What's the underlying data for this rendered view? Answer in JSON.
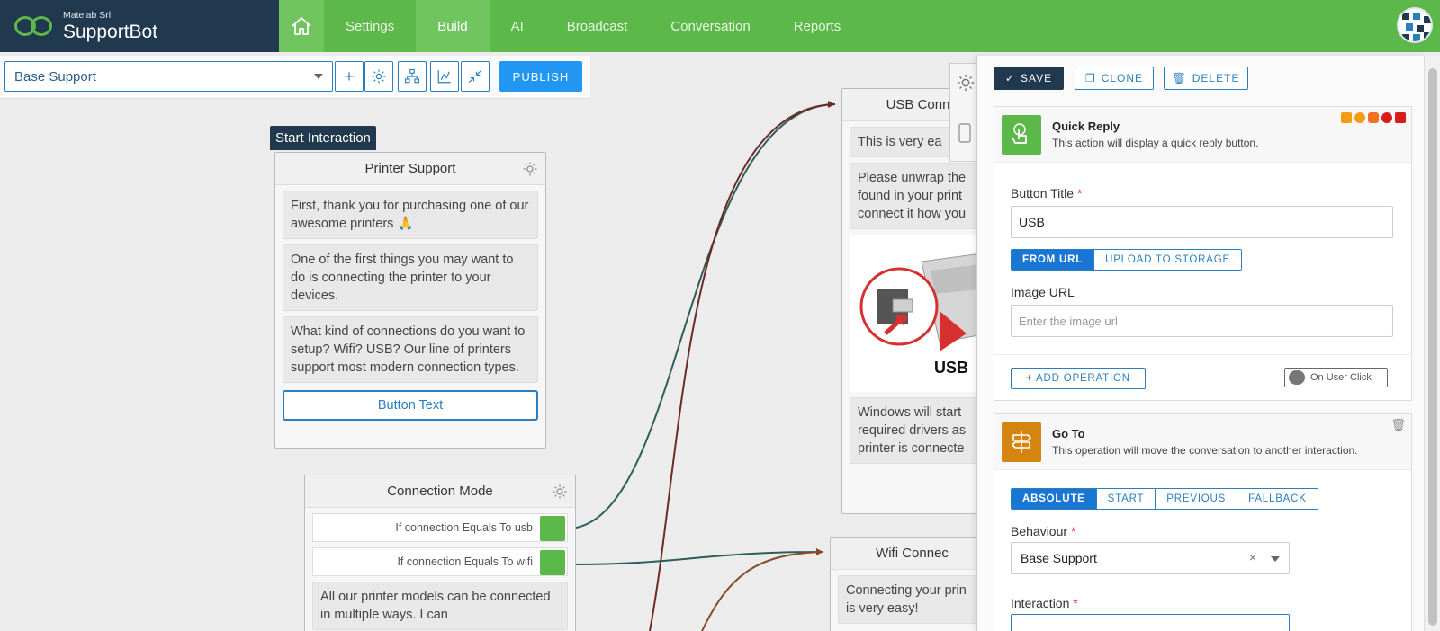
{
  "app": {
    "company": "Matelab Srl",
    "name": "SupportBot"
  },
  "nav": {
    "items": [
      {
        "label": "Settings",
        "active": false
      },
      {
        "label": "Build",
        "active": true
      },
      {
        "label": "AI",
        "active": false
      },
      {
        "label": "Broadcast",
        "active": false
      },
      {
        "label": "Conversation",
        "active": false
      },
      {
        "label": "Reports",
        "active": false
      }
    ]
  },
  "toolbar": {
    "flow_selected": "Base Support",
    "publish_label": "PUBLISH",
    "buttons": [
      "plus-icon",
      "gear-icon",
      "hierarchy-icon",
      "chart-icon",
      "compress-icon"
    ]
  },
  "canvas": {
    "start_tag": "Start Interaction",
    "printer_node": {
      "title": "Printer Support",
      "bubbles": [
        "First, thank you for purchasing one of our awesome printers 🙏",
        "One of the first things you may want to do is connecting the printer to your devices.",
        "What kind of connections do you want to setup? Wifi? USB? Our line of printers support most modern connection types."
      ],
      "button_text": "Button Text"
    },
    "connection_node": {
      "title": "Connection Mode",
      "conditions": [
        "If connection Equals To usb",
        "If connection Equals To wifi"
      ],
      "bubble": "All our printer models can be connected in multiple ways. I can"
    },
    "usb_node": {
      "title": "USB Conn",
      "bubbles": [
        "This is very ea",
        "Please unwrap the found in your print connect it how you",
        "Windows will start required drivers as printer is connecte"
      ],
      "image_caption": "USB"
    },
    "wifi_node": {
      "title": "Wifi Connec",
      "bubble": "Connecting your prin is very easy!"
    }
  },
  "panel": {
    "save_label": "SAVE",
    "clone_label": "CLONE",
    "delete_label": "DELETE",
    "quick_reply": {
      "title": "Quick Reply",
      "description": "This action will display a quick reply button.",
      "button_title_label": "Button Title",
      "button_title_value": "USB",
      "source_tabs": [
        {
          "label": "FROM URL",
          "active": true
        },
        {
          "label": "UPLOAD TO STORAGE",
          "active": false
        }
      ],
      "image_url_label": "Image URL",
      "image_url_placeholder": "Enter the image url",
      "add_operation_label": "+ ADD OPERATION",
      "on_user_click_label": "On User Click"
    },
    "goto": {
      "title": "Go To",
      "description": "This operation will move the conversation to another interaction.",
      "mode_tabs": [
        {
          "label": "ABSOLUTE",
          "active": true
        },
        {
          "label": "START",
          "active": false
        },
        {
          "label": "PREVIOUS",
          "active": false
        },
        {
          "label": "FALLBACK",
          "active": false
        }
      ],
      "behaviour_label": "Behaviour",
      "behaviour_value": "Base Support",
      "interaction_label": "Interaction"
    }
  },
  "colors": {
    "nav_green": "#5cb848",
    "brand_dark": "#20394f",
    "accent_blue": "#2b7fbf",
    "quick_reply_icon": "#5cb848",
    "goto_icon": "#d4850f"
  }
}
